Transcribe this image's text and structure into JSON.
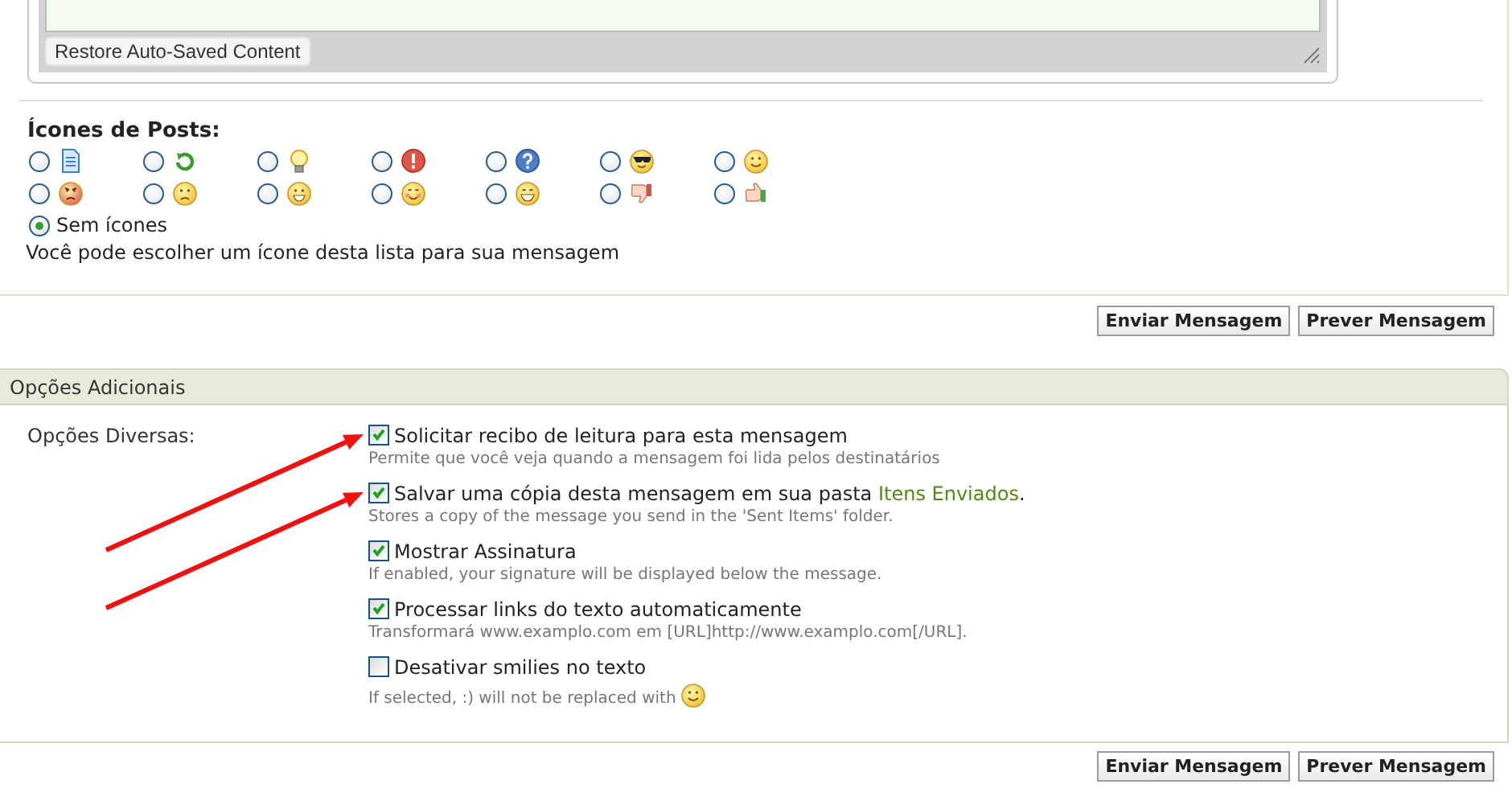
{
  "editor": {
    "restore_button": "Restore Auto-Saved Content"
  },
  "post_icons": {
    "title": "Ícones de Posts:",
    "icons": [
      {
        "kind": "document",
        "selected": false
      },
      {
        "kind": "recycle",
        "selected": false
      },
      {
        "kind": "lightbulb",
        "selected": false
      },
      {
        "kind": "exclamation",
        "selected": false
      },
      {
        "kind": "question",
        "selected": false
      },
      {
        "kind": "cool",
        "selected": false
      },
      {
        "kind": "smile",
        "selected": false
      },
      {
        "kind": "angry",
        "selected": false
      },
      {
        "kind": "sad",
        "selected": false
      },
      {
        "kind": "grin",
        "selected": false
      },
      {
        "kind": "blush",
        "selected": false
      },
      {
        "kind": "laugh",
        "selected": false
      },
      {
        "kind": "thumbsdown",
        "selected": false
      },
      {
        "kind": "thumbsup",
        "selected": false
      }
    ],
    "none_option": {
      "label": "Sem ícones",
      "selected": true
    },
    "hint": "Você pode escolher um ícone desta lista para sua mensagem"
  },
  "buttons_top": [
    "Enviar Mensagem",
    "Prever Mensagem"
  ],
  "additional_options": {
    "title": "Opções Adicionais",
    "group_label": "Opções Diversas:",
    "options": [
      {
        "checked": true,
        "arrow": true,
        "label": "Solicitar recibo de leitura para esta mensagem",
        "description": "Permite que você veja quando a mensagem foi lida pelos destinatários"
      },
      {
        "checked": true,
        "arrow": true,
        "label": "Salvar uma cópia desta mensagem em sua pasta",
        "link": "Itens Enviados",
        "after_link": ".",
        "description": "Stores a copy of the message you send in the 'Sent Items' folder."
      },
      {
        "checked": true,
        "label": "Mostrar Assinatura",
        "description": "If enabled, your signature will be displayed below the message."
      },
      {
        "checked": true,
        "label": "Processar links do texto automaticamente",
        "description": "Transformará www.examplo.com em [URL]http://www.examplo.com[/URL]."
      },
      {
        "checked": false,
        "label": "Desativar smilies no texto",
        "description": "If selected, :) will not be replaced with",
        "trailing_icon": true
      }
    ]
  },
  "buttons_bottom": [
    "Enviar Mensagem",
    "Prever Mensagem"
  ]
}
